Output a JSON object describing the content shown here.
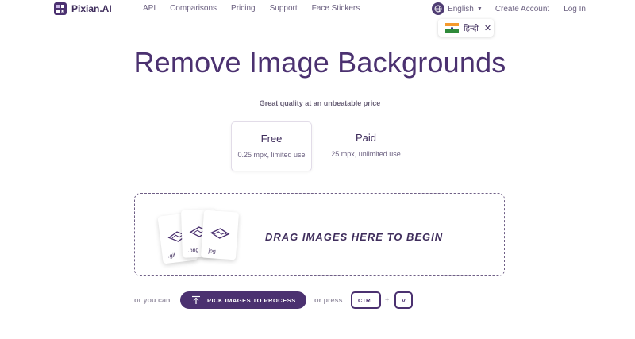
{
  "brand": {
    "name": "Pixian.AI"
  },
  "nav": {
    "items": [
      {
        "label": "API"
      },
      {
        "label": "Comparisons"
      },
      {
        "label": "Pricing"
      },
      {
        "label": "Support"
      },
      {
        "label": "Face Stickers"
      }
    ],
    "language": "English",
    "create_account": "Create Account",
    "login": "Log In"
  },
  "language_suggestion": {
    "label": "हिन्दी",
    "close": "✕"
  },
  "hero": {
    "title": "Remove Image Backgrounds",
    "subtitle": "Great quality at an unbeatable price"
  },
  "plans": [
    {
      "name": "Free",
      "desc": "0.25 mpx, limited use",
      "selected": true
    },
    {
      "name": "Paid",
      "desc": "25 mpx, unlimited use",
      "selected": false
    }
  ],
  "dropzone": {
    "text": "DRAG IMAGES HERE TO BEGIN",
    "file_types": [
      ".gif",
      ".png",
      ".jpg"
    ]
  },
  "actions": {
    "or_you_can": "or you can",
    "pick_button": "PICK IMAGES TO PROCESS",
    "or_press": "or press",
    "key_ctrl": "CTRL",
    "plus": "+",
    "key_v": "V"
  },
  "colors": {
    "brand": "#4b3170",
    "text_muted": "#6b6080"
  }
}
